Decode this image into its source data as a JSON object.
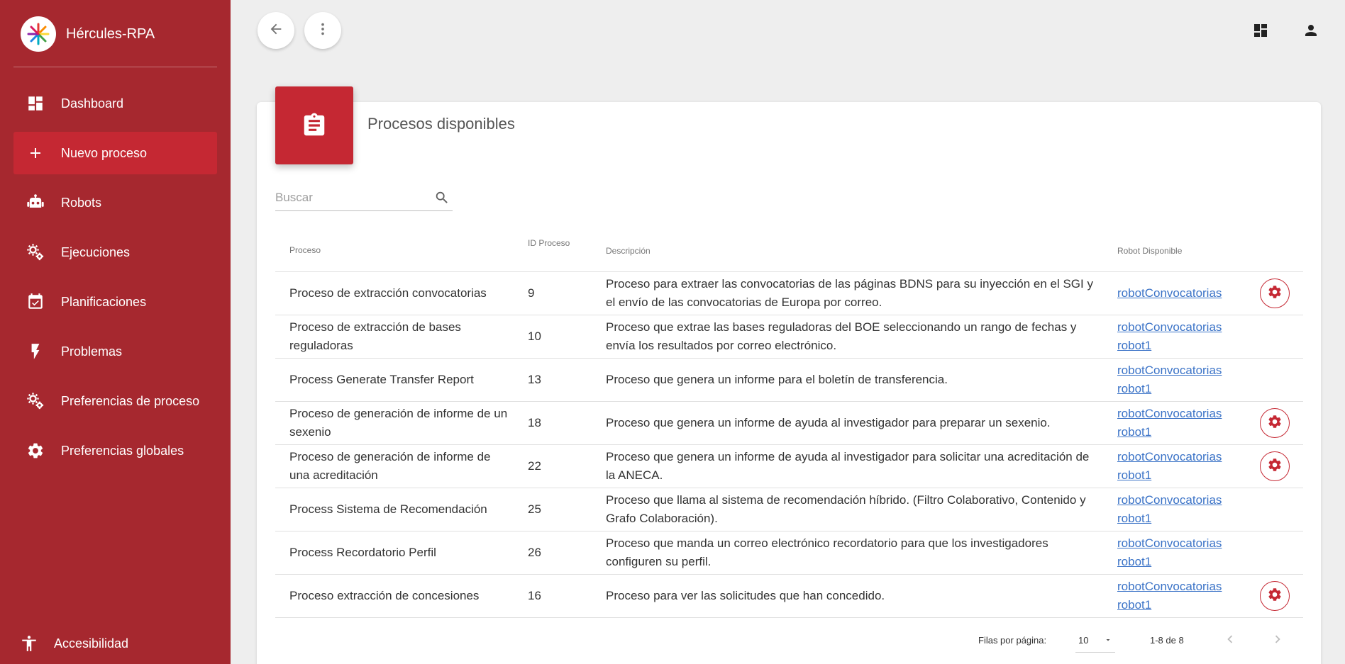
{
  "app": {
    "title": "Hércules-RPA"
  },
  "sidebar": {
    "items": [
      {
        "label": "Dashboard",
        "icon": "dashboard-icon"
      },
      {
        "label": "Nuevo proceso",
        "icon": "plus-icon",
        "active": true
      },
      {
        "label": "Robots",
        "icon": "robot-icon"
      },
      {
        "label": "Ejecuciones",
        "icon": "gears-icon"
      },
      {
        "label": "Planificaciones",
        "icon": "calendar-check-icon"
      },
      {
        "label": "Problemas",
        "icon": "lightning-icon"
      },
      {
        "label": "Preferencias de proceso",
        "icon": "gears-icon"
      },
      {
        "label": "Preferencias globales",
        "icon": "gear-icon"
      }
    ],
    "accessibility_label": "Accesibilidad"
  },
  "page": {
    "title": "Procesos disponibles"
  },
  "search": {
    "placeholder": "Buscar"
  },
  "table": {
    "headers": {
      "process": "Proceso",
      "id": "ID Proceso",
      "description": "Descripción",
      "robot": "Robot Disponible"
    },
    "rows": [
      {
        "name": "Proceso de extracción convocatorias",
        "id": "9",
        "description": "Proceso para extraer las convocatorias de las páginas BDNS para su inyección en el SGI y el envío de las convocatorias de Europa por correo.",
        "robots": [
          "robotConvocatorias"
        ],
        "has_settings": true
      },
      {
        "name": "Proceso de extracción de bases reguladoras",
        "id": "10",
        "description": "Proceso que extrae las bases reguladoras del BOE seleccionando un rango de fechas y envía los resultados por correo electrónico.",
        "robots": [
          "robotConvocatorias",
          "robot1"
        ],
        "has_settings": false
      },
      {
        "name": "Process Generate Transfer Report",
        "id": "13",
        "description": "Proceso que genera un informe para el boletín de transferencia.",
        "robots": [
          "robotConvocatorias",
          "robot1"
        ],
        "has_settings": false
      },
      {
        "name": "Proceso de generación de informe de un sexenio",
        "id": "18",
        "description": "Proceso que genera un informe de ayuda al investigador para preparar un sexenio.",
        "robots": [
          "robotConvocatorias",
          "robot1"
        ],
        "has_settings": true
      },
      {
        "name": "Proceso de generación de informe de una acreditación",
        "id": "22",
        "description": "Proceso que genera un informe de ayuda al investigador para solicitar una acreditación de la ANECA.",
        "robots": [
          "robotConvocatorias",
          "robot1"
        ],
        "has_settings": true
      },
      {
        "name": "Process Sistema de Recomendación",
        "id": "25",
        "description": "Proceso que llama al sistema de recomendación híbrido. (Filtro Colaborativo, Contenido y Grafo Colaboración).",
        "robots": [
          "robotConvocatorias",
          "robot1"
        ],
        "has_settings": false
      },
      {
        "name": "Process Recordatorio Perfil",
        "id": "26",
        "description": "Proceso que manda un correo electrónico recordatorio para que los investigadores configuren su perfil.",
        "robots": [
          "robotConvocatorias",
          "robot1"
        ],
        "has_settings": false
      },
      {
        "name": "Proceso extracción de concesiones",
        "id": "16",
        "description": "Proceso para ver las solicitudes que han concedido.",
        "robots": [
          "robotConvocatorias",
          "robot1"
        ],
        "has_settings": true
      }
    ]
  },
  "pagination": {
    "rows_label": "Filas por página:",
    "rows_value": "10",
    "range": "1-8 de 8"
  },
  "colors": {
    "sidebar": "#a6282f",
    "accent": "#c52833",
    "link": "#3b73c7"
  }
}
